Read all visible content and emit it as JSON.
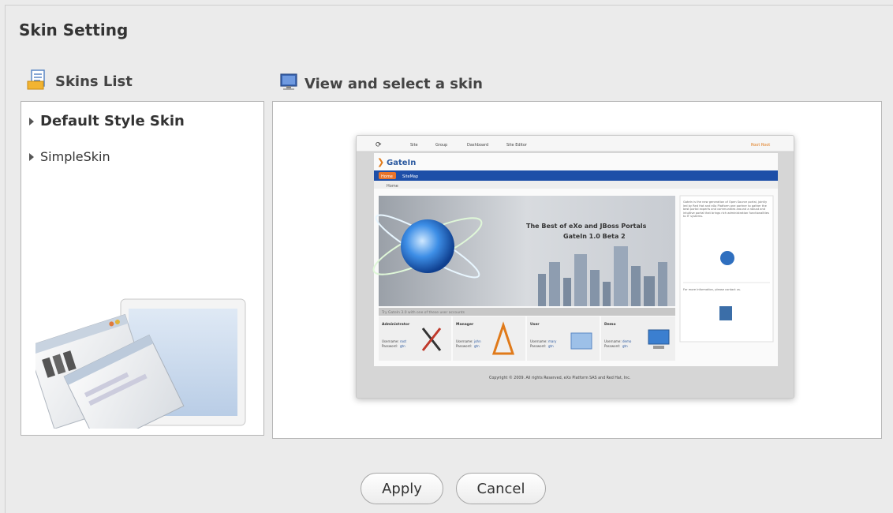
{
  "title": "Skin Setting",
  "skins_list": {
    "header": "Skins List",
    "icon": "document-list-icon",
    "items": [
      {
        "label": "Default Style Skin",
        "selected": true
      },
      {
        "label": "SimpleSkin",
        "selected": false
      }
    ]
  },
  "view": {
    "header": "View and select a skin",
    "icon": "monitor-icon",
    "preview": {
      "toolbar": [
        "Site",
        "Group",
        "Dashboard",
        "Site Editor"
      ],
      "toolbar_user": "Root Root",
      "logo": "GateIn",
      "nav_tabs": [
        "Home",
        "SiteMap"
      ],
      "breadcrumb": "Home",
      "banner_line1": "The Best of eXo and JBoss Portals",
      "banner_line2": "GateIn 1.0 Beta 2",
      "side_text": "GateIn is the new generation of Open Source portal, jointly led by Red Hat and eXo Platform one partner to gather the best portal experts and communities around a robust and intuitive portal that brings rich administration functionalities to IT systems.",
      "side_contact": "For more information, please contact us.",
      "accounts_caption": "Try GateIn 3.0 with one of these user accounts",
      "accounts": [
        {
          "role": "Administrator",
          "user": "root",
          "pass": "gtn"
        },
        {
          "role": "Manager",
          "user": "john",
          "pass": "gtn"
        },
        {
          "role": "User",
          "user": "mary",
          "pass": "gtn"
        },
        {
          "role": "Demo",
          "user": "demo",
          "pass": "gtn"
        }
      ],
      "username_label": "Username:",
      "password_label": "Password:",
      "footer": "Copyright © 2009. All rights Reserved, eXo Platform SAS and Red Hat, Inc."
    }
  },
  "buttons": {
    "apply": "Apply",
    "cancel": "Cancel"
  }
}
